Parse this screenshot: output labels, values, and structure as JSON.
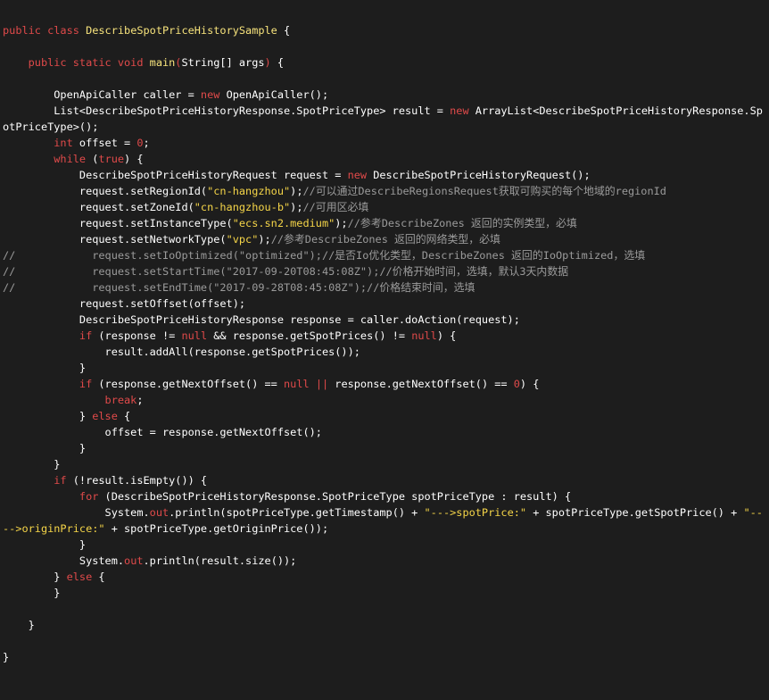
{
  "colors": {
    "background": "#1d1d1d",
    "keyword": "#e04a4a",
    "class_name": "#f7e37c",
    "string": "#f5d548",
    "comment": "#9b9b9b",
    "text": "#ffffff"
  },
  "code": {
    "lines": [
      [
        [
          "kw",
          "public class "
        ],
        [
          "type",
          "DescribeSpotPriceHistorySample"
        ],
        [
          "id",
          " {"
        ]
      ],
      [],
      [
        [
          "kw",
          "    public static void "
        ],
        [
          "type",
          "main"
        ],
        [
          "kw",
          "("
        ],
        [
          "id",
          "String[] args"
        ],
        [
          "kw",
          ")"
        ],
        [
          "id",
          " {"
        ]
      ],
      [],
      [
        [
          "id",
          "        OpenApiCaller caller = "
        ],
        [
          "kw",
          "new"
        ],
        [
          "id",
          " OpenApiCaller();"
        ]
      ],
      [
        [
          "id",
          "        List<DescribeSpotPriceHistoryResponse.SpotPriceType> result = "
        ],
        [
          "kw",
          "new"
        ],
        [
          "id",
          " ArrayList<DescribeSpotPriceHistoryResponse.Sp"
        ]
      ],
      [
        [
          "id",
          "otPriceType>();"
        ]
      ],
      [
        [
          "kw",
          "        int"
        ],
        [
          "id",
          " offset = "
        ],
        [
          "num",
          "0"
        ],
        [
          "id",
          ";"
        ]
      ],
      [
        [
          "kw",
          "        while"
        ],
        [
          "id",
          " ("
        ],
        [
          "kw",
          "true"
        ],
        [
          "id",
          ") {"
        ]
      ],
      [
        [
          "id",
          "            DescribeSpotPriceHistoryRequest request = "
        ],
        [
          "kw",
          "new"
        ],
        [
          "id",
          " DescribeSpotPriceHistoryRequest();"
        ]
      ],
      [
        [
          "id",
          "            request.setRegionId("
        ],
        [
          "str",
          "\"cn-hangzhou\""
        ],
        [
          "id",
          ");"
        ],
        [
          "cm",
          "//可以通过DescribeRegionsRequest获取可购买的每个地域的regionId"
        ]
      ],
      [
        [
          "id",
          "            request.setZoneId("
        ],
        [
          "str",
          "\"cn-hangzhou-b\""
        ],
        [
          "id",
          ");"
        ],
        [
          "cm",
          "//可用区必填"
        ]
      ],
      [
        [
          "id",
          "            request.setInstanceType("
        ],
        [
          "str",
          "\"ecs.sn2.medium\""
        ],
        [
          "id",
          ");"
        ],
        [
          "cm",
          "//参考DescribeZones 返回的实例类型，必填"
        ]
      ],
      [
        [
          "id",
          "            request.setNetworkType("
        ],
        [
          "str",
          "\"vpc\""
        ],
        [
          "id",
          ");"
        ],
        [
          "cm",
          "//参考DescribeZones 返回的网络类型，必填"
        ]
      ],
      [
        [
          "cm",
          "//            request.setIoOptimized(\"optimized\");//是否Io优化类型，DescribeZones 返回的IoOptimized，选填"
        ]
      ],
      [
        [
          "cm",
          "//            request.setStartTime(\"2017-09-20T08:45:08Z\");//价格开始时间，选填，默认3天内数据"
        ]
      ],
      [
        [
          "cm",
          "//            request.setEndTime(\"2017-09-28T08:45:08Z\");//价格结束时间，选填"
        ]
      ],
      [
        [
          "id",
          "            request.setOffset(offset);"
        ]
      ],
      [
        [
          "id",
          "            DescribeSpotPriceHistoryResponse response = caller.doAction(request);"
        ]
      ],
      [
        [
          "kw",
          "            if"
        ],
        [
          "id",
          " (response != "
        ],
        [
          "kw",
          "null"
        ],
        [
          "id",
          " && response.getSpotPrices() != "
        ],
        [
          "kw",
          "null"
        ],
        [
          "id",
          ") {"
        ]
      ],
      [
        [
          "id",
          "                result.addAll(response.getSpotPrices());"
        ]
      ],
      [
        [
          "id",
          "            }"
        ]
      ],
      [
        [
          "kw",
          "            if"
        ],
        [
          "id",
          " (response.getNextOffset() == "
        ],
        [
          "kw",
          "null"
        ],
        [
          "id",
          " "
        ],
        [
          "kw",
          "||"
        ],
        [
          "id",
          " response.getNextOffset() == "
        ],
        [
          "num",
          "0"
        ],
        [
          "id",
          ") {"
        ]
      ],
      [
        [
          "kw",
          "                break"
        ],
        [
          "id",
          ";"
        ]
      ],
      [
        [
          "id",
          "            } "
        ],
        [
          "kw",
          "else"
        ],
        [
          "id",
          " {"
        ]
      ],
      [
        [
          "id",
          "                offset = response.getNextOffset();"
        ]
      ],
      [
        [
          "id",
          "            }"
        ]
      ],
      [
        [
          "id",
          "        }"
        ]
      ],
      [
        [
          "kw",
          "        if"
        ],
        [
          "id",
          " (!result.isEmpty()) {"
        ]
      ],
      [
        [
          "kw",
          "            for"
        ],
        [
          "id",
          " (DescribeSpotPriceHistoryResponse.SpotPriceType spotPriceType : result) {"
        ]
      ],
      [
        [
          "id",
          "                System."
        ],
        [
          "kw",
          "out"
        ],
        [
          "id",
          ".println(spotPriceType.getTimestamp() + "
        ],
        [
          "str",
          "\"--->spotPrice:\""
        ],
        [
          "id",
          " + spotPriceType.getSpotPrice() + "
        ],
        [
          "str",
          "\"--"
        ]
      ],
      [
        [
          "str",
          "-->originPrice:\""
        ],
        [
          "id",
          " + spotPriceType.getOriginPrice());"
        ]
      ],
      [
        [
          "id",
          "            }"
        ]
      ],
      [
        [
          "id",
          "            System."
        ],
        [
          "kw",
          "out"
        ],
        [
          "id",
          ".println(result.size());"
        ]
      ],
      [
        [
          "id",
          "        } "
        ],
        [
          "kw",
          "else"
        ],
        [
          "id",
          " {"
        ]
      ],
      [
        [
          "id",
          "        }"
        ]
      ],
      [],
      [
        [
          "id",
          "    }"
        ]
      ],
      [],
      [
        [
          "id",
          "}"
        ]
      ]
    ]
  }
}
